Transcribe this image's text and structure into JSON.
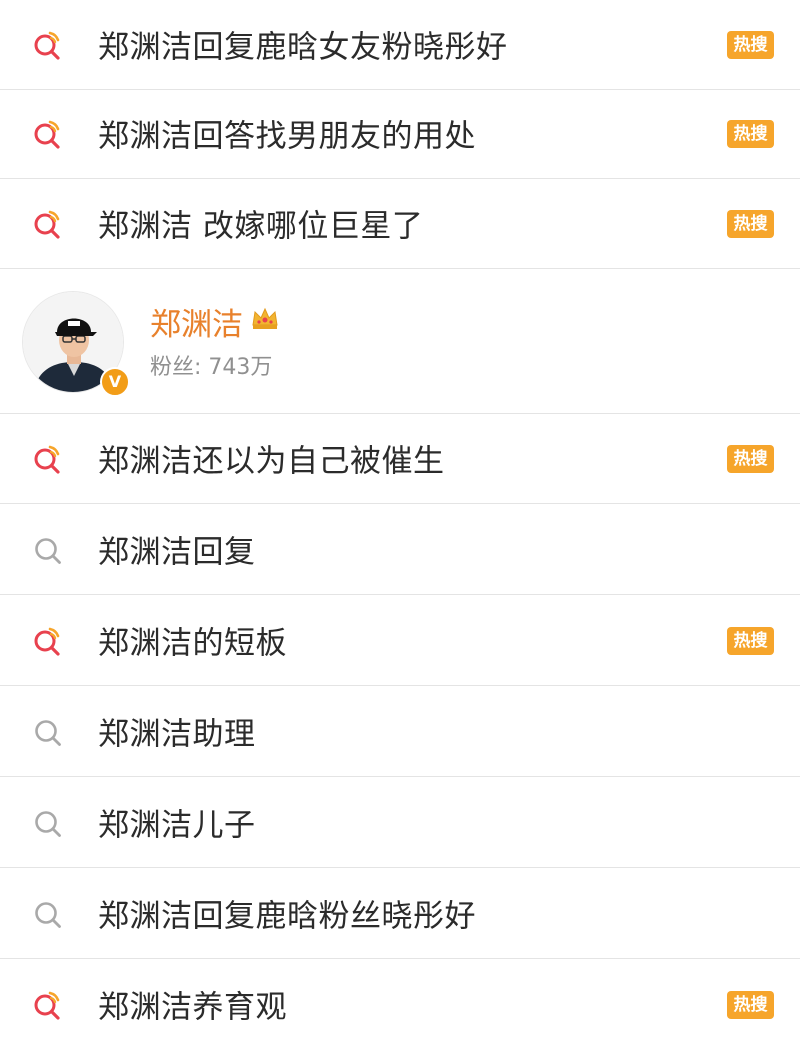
{
  "colors": {
    "hot_icon": "#e8414e",
    "hot_icon_accent": "#f6a52b",
    "normal_icon": "#a9a9a9",
    "badge_bg": "#f6a52b",
    "username": "#e8812c"
  },
  "items": [
    {
      "text": "郑渊洁回复鹿晗女友粉晓彤好",
      "icon": "hot-search-icon",
      "badge": "热搜"
    },
    {
      "text": "郑渊洁回答找男朋友的用处",
      "icon": "hot-search-icon",
      "badge": "热搜"
    },
    {
      "text": "郑渊洁 改嫁哪位巨星了",
      "icon": "hot-search-icon",
      "badge": "热搜"
    },
    {
      "text": "郑渊洁还以为自己被催生",
      "icon": "hot-search-icon",
      "badge": "热搜"
    },
    {
      "text": "郑渊洁回复",
      "icon": "search-icon",
      "badge": null
    },
    {
      "text": "郑渊洁的短板",
      "icon": "hot-search-icon",
      "badge": "热搜"
    },
    {
      "text": "郑渊洁助理",
      "icon": "search-icon",
      "badge": null
    },
    {
      "text": "郑渊洁儿子",
      "icon": "search-icon",
      "badge": null
    },
    {
      "text": "郑渊洁回复鹿晗粉丝晓彤好",
      "icon": "search-icon",
      "badge": null
    },
    {
      "text": "郑渊洁养育观",
      "icon": "hot-search-icon",
      "badge": "热搜"
    }
  ],
  "user": {
    "name": "郑渊洁",
    "fans": "粉丝: 743万",
    "verified_badge": "V",
    "icons": [
      "avatar",
      "verified-v-icon",
      "crown-icon"
    ]
  }
}
